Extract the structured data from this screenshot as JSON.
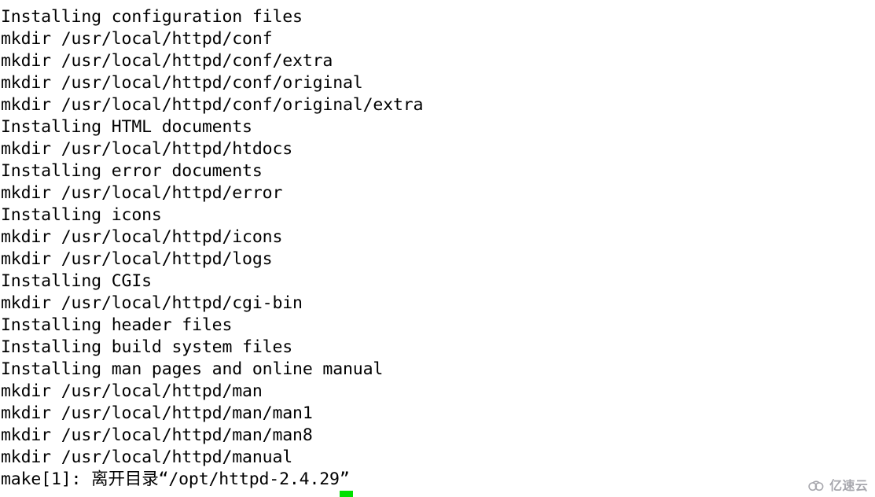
{
  "terminal": {
    "background_color": "#ffffff",
    "text_color": "#000000",
    "cursor_color": "#00e000",
    "lines": [
      "Installing configuration files",
      "mkdir /usr/local/httpd/conf",
      "mkdir /usr/local/httpd/conf/extra",
      "mkdir /usr/local/httpd/conf/original",
      "mkdir /usr/local/httpd/conf/original/extra",
      "Installing HTML documents",
      "mkdir /usr/local/httpd/htdocs",
      "Installing error documents",
      "mkdir /usr/local/httpd/error",
      "Installing icons",
      "mkdir /usr/local/httpd/icons",
      "mkdir /usr/local/httpd/logs",
      "Installing CGIs",
      "mkdir /usr/local/httpd/cgi-bin",
      "Installing header files",
      "Installing build system files",
      "Installing man pages and online manual",
      "mkdir /usr/local/httpd/man",
      "mkdir /usr/local/httpd/man/man1",
      "mkdir /usr/local/httpd/man/man8",
      "mkdir /usr/local/httpd/manual",
      "make[1]: 离开目录“/opt/httpd-2.4.29”"
    ]
  },
  "watermark": {
    "text": "亿速云",
    "icon": "cloud-icon",
    "color": "#9b9ba2"
  }
}
